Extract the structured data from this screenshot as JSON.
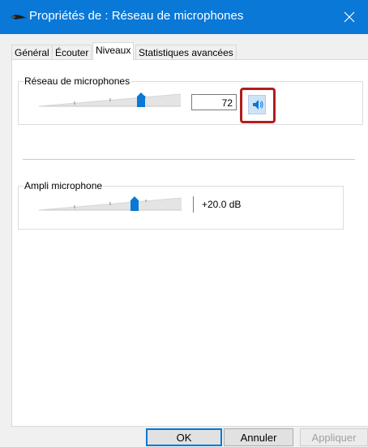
{
  "window": {
    "title": "Propriétés de : Réseau de microphones",
    "accent": "#0a78d7"
  },
  "tabs": [
    {
      "label": "Général"
    },
    {
      "label": "Écouter"
    },
    {
      "label": "Niveaux"
    },
    {
      "label": "Statistiques avancées"
    }
  ],
  "levels": {
    "microphone": {
      "label": "Réseau de microphones",
      "value": "72",
      "level_fraction": 0.72,
      "mute_icon": "speaker-icon"
    },
    "boost": {
      "label": "Ampli microphone",
      "value": "+20.0 dB",
      "level_fraction": 0.67
    }
  },
  "buttons": {
    "ok": "OK",
    "cancel": "Annuler",
    "apply": "Appliquer"
  },
  "colors": {
    "highlight": "#b11e1e",
    "thumb": "#0a78d7"
  }
}
